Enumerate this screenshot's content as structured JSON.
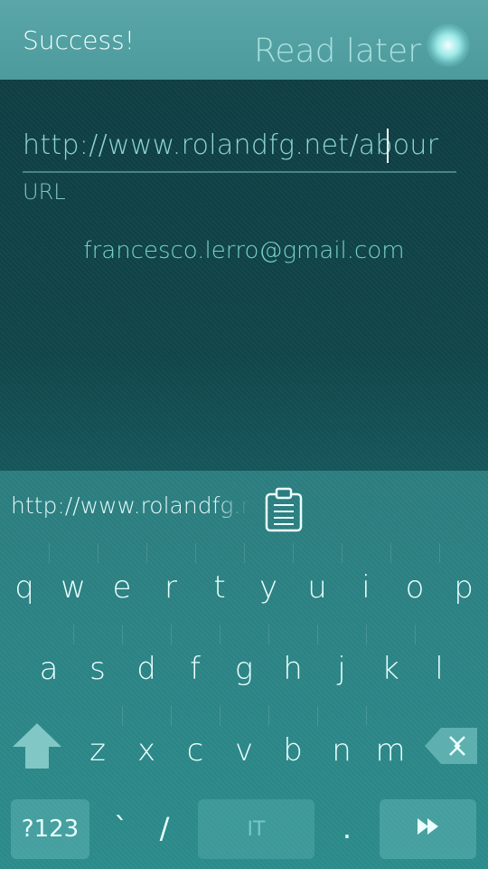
{
  "banner": {
    "title": "Success!",
    "action_label": "Read later"
  },
  "form": {
    "url_value": "http://www.rolandfg.net/abour",
    "url_label": "URL",
    "email": "francesco.lerro@gmail.com"
  },
  "keyboard": {
    "suggestion": "http://www.rolandfg.net/abour",
    "row1": [
      "q",
      "w",
      "e",
      "r",
      "t",
      "y",
      "u",
      "i",
      "o",
      "p"
    ],
    "row2": [
      "a",
      "s",
      "d",
      "f",
      "g",
      "h",
      "j",
      "k",
      "l"
    ],
    "row3": [
      "z",
      "x",
      "c",
      "v",
      "b",
      "n",
      "m"
    ],
    "symbols_label": "?123",
    "punct_left": [
      "`",
      "/"
    ],
    "space_label": "IT",
    "punct_right": "."
  },
  "icons": {
    "clipboard": "clipboard-icon",
    "shift": "shift-icon",
    "backspace": "backspace-icon",
    "enter": "enter-icon",
    "glow": "pulley-indicator-icon"
  },
  "colors": {
    "banner": "#5aa6a8",
    "background": "#0f4448",
    "keyboard": "#2a8a8a",
    "accent": "#8ed6d5"
  }
}
